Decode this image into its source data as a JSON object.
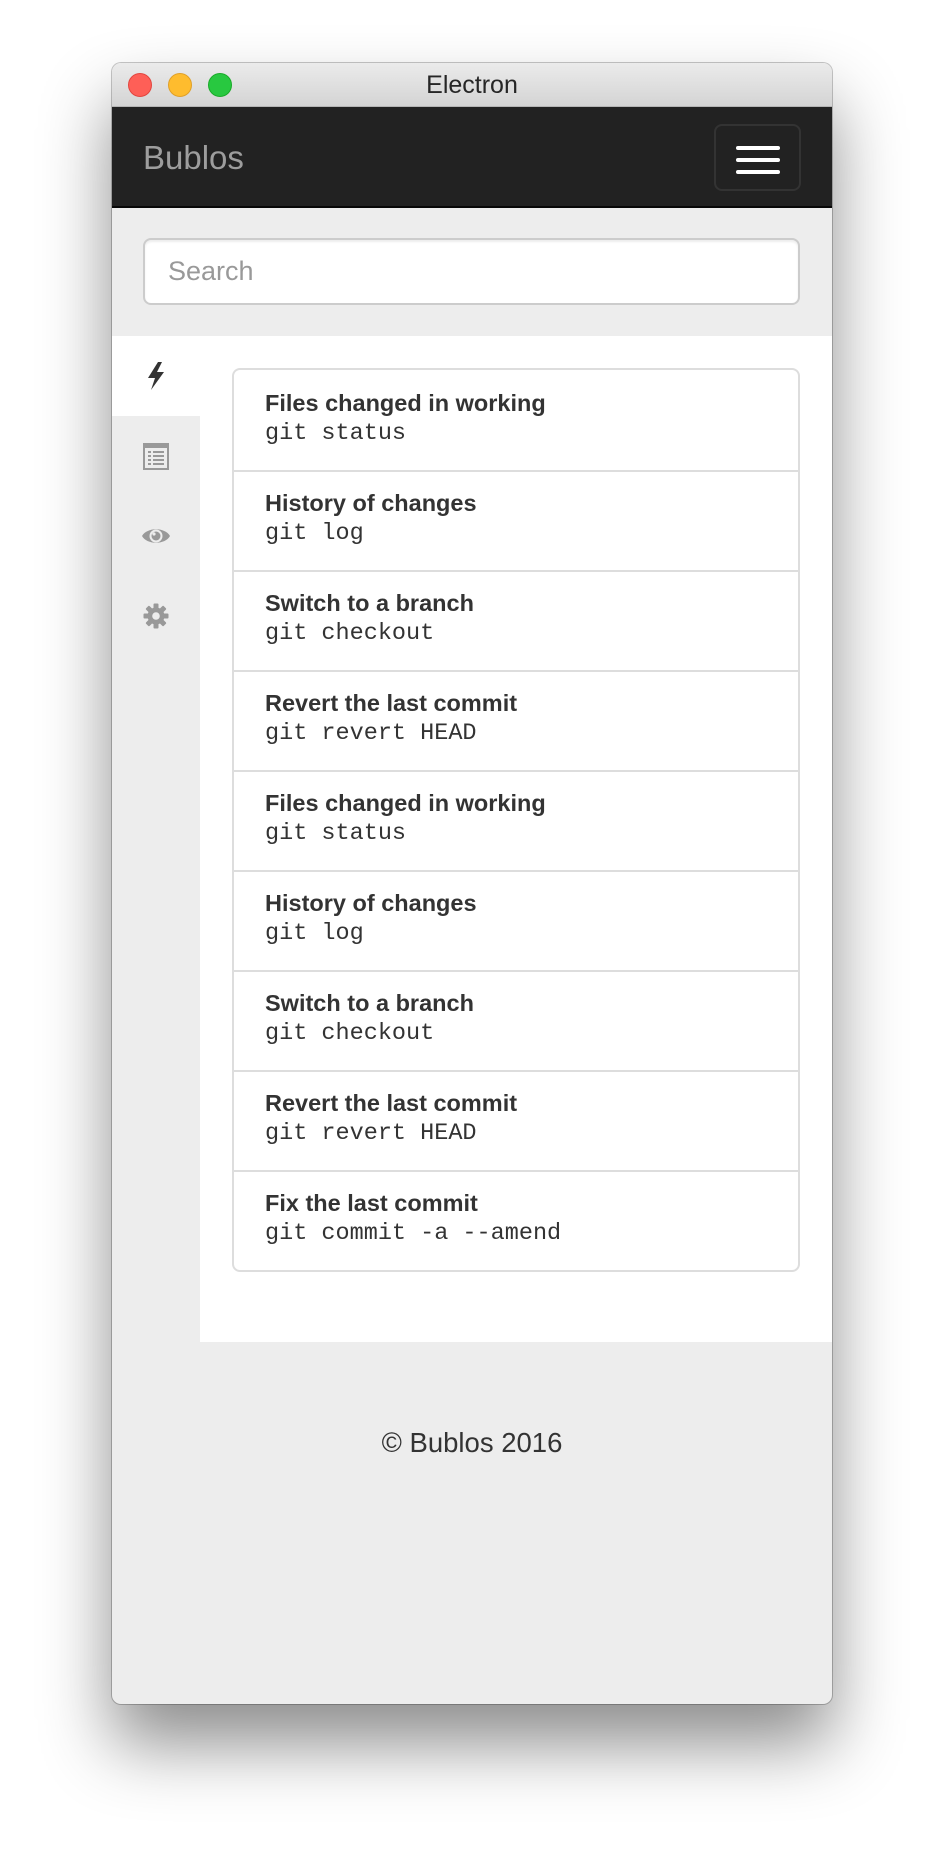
{
  "window": {
    "title": "Electron",
    "controls": [
      "close",
      "minimize",
      "maximize"
    ]
  },
  "navbar": {
    "brand": "Bublos",
    "menu_icon": "hamburger-icon",
    "menu_label": "Toggle navigation"
  },
  "search": {
    "placeholder": "Search",
    "value": ""
  },
  "sidebar": {
    "tabs": [
      {
        "icon": "bolt-icon",
        "active": true
      },
      {
        "icon": "list-icon",
        "active": false
      },
      {
        "icon": "eye-icon",
        "active": false
      },
      {
        "icon": "gear-icon",
        "active": false
      }
    ]
  },
  "commands": [
    {
      "title": "Files changed in working",
      "command": "git status"
    },
    {
      "title": "History of changes",
      "command": "git log"
    },
    {
      "title": "Switch to a branch",
      "command": "git checkout"
    },
    {
      "title": "Revert the last commit",
      "command": "git revert HEAD"
    },
    {
      "title": "Files changed in working",
      "command": "git status"
    },
    {
      "title": "History of changes",
      "command": "git log"
    },
    {
      "title": "Switch to a branch",
      "command": "git checkout"
    },
    {
      "title": "Revert the last commit",
      "command": "git revert HEAD"
    },
    {
      "title": "Fix the last commit",
      "command": "git commit -a --amend"
    }
  ],
  "footer": {
    "text": "© Bublos 2016"
  },
  "colors": {
    "navbar_bg": "#222222",
    "brand_text": "#9d9d9d",
    "page_bg": "#ededed",
    "text": "#333333",
    "icon_inactive": "#999999",
    "icon_active": "#333333",
    "border": "#dddddd"
  }
}
